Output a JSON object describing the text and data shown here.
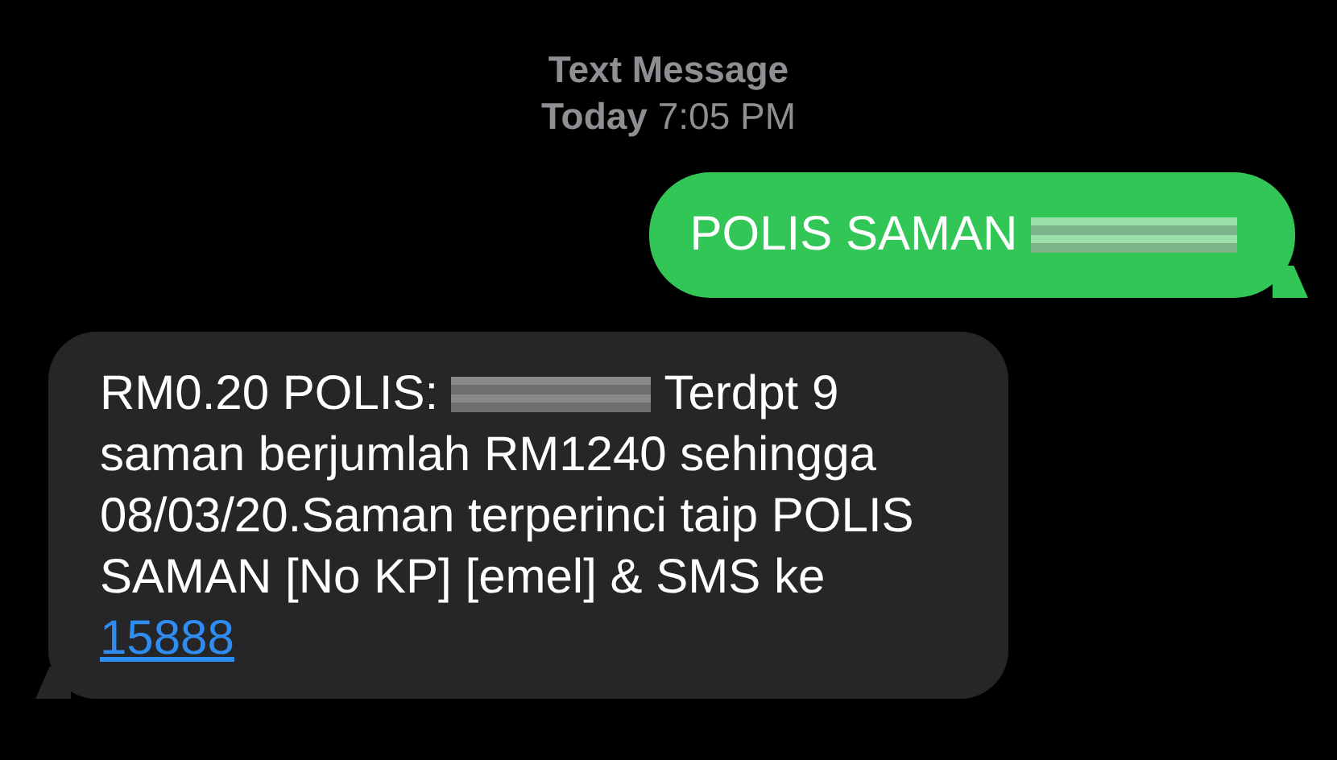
{
  "header": {
    "title": "Text Message",
    "timestamp": "**Today** 7:05 PM"
  },
  "messages": [
    {
      "sent": true,
      "parts": [
        {
          "kind": "text",
          "text": "POLIS SAMAN "
        },
        {
          "kind": "redacted"
        }
      ]
    },
    {
      "sent": false,
      "parts": [
        {
          "kind": "text",
          "text": "RM0.20 POLIS: "
        },
        {
          "kind": "redacted"
        },
        {
          "kind": "text",
          "text": " Terdpt 9 saman berjumlah RM1240 sehingga 08/03/20.Saman terperinci taip POLIS SAMAN [No KP] [emel] & SMS ke "
        },
        {
          "kind": "link",
          "text": "15888"
        }
      ]
    }
  ]
}
